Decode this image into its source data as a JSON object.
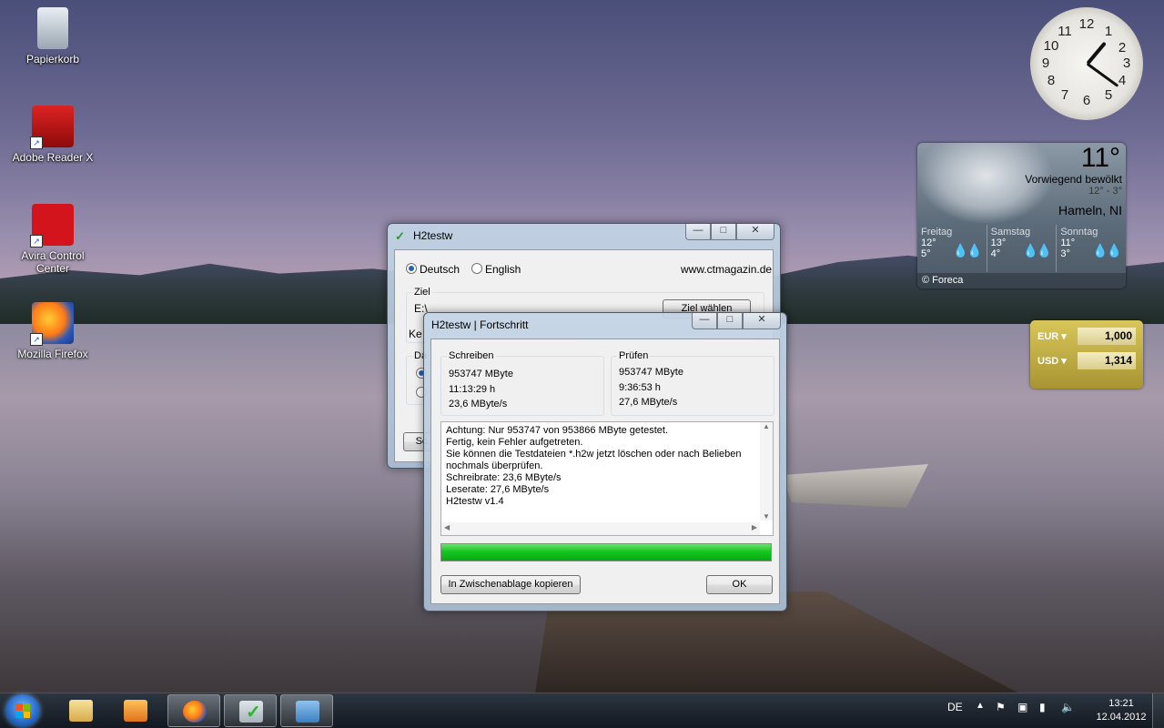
{
  "desktop": {
    "icons": [
      {
        "label": "Papierkorb"
      },
      {
        "label": "Adobe Reader X"
      },
      {
        "label": "Avira Control Center"
      },
      {
        "label": "Mozilla Firefox"
      }
    ]
  },
  "weather": {
    "temp": "11°",
    "condition": "Vorwiegend bewölkt",
    "range": "12°  -  3°",
    "city": "Hameln, NI",
    "days": [
      {
        "name": "Freitag",
        "hi": "12°",
        "lo": "5°"
      },
      {
        "name": "Samstag",
        "hi": "13°",
        "lo": "4°"
      },
      {
        "name": "Sonntag",
        "hi": "11°",
        "lo": "3°"
      }
    ],
    "source": "© Foreca"
  },
  "currency": {
    "rows": [
      {
        "code": "EUR",
        "value": "1,000"
      },
      {
        "code": "USD",
        "value": "1,314"
      }
    ]
  },
  "main_window": {
    "title": "H2testw",
    "lang_de": "Deutsch",
    "lang_en": "English",
    "url": "www.ctmagazin.de",
    "target_group": "Ziel",
    "target_value": "E:\\",
    "choose_target": "Ziel wählen",
    "partial_ke": "Ke",
    "partial_da": "Da",
    "partial_sc": "Sc"
  },
  "progress_window": {
    "title": "H2testw | Fortschritt",
    "write": {
      "label": "Schreiben",
      "amount": "953747 MByte",
      "time": "11:13:29 h",
      "rate": "23,6 MByte/s"
    },
    "verify": {
      "label": "Prüfen",
      "amount": "953747 MByte",
      "time": "9:36:53 h",
      "rate": "27,6 MByte/s"
    },
    "log": [
      "Achtung: Nur 953747 von 953866 MByte getestet.",
      "Fertig, kein Fehler aufgetreten.",
      "Sie können die Testdateien *.h2w jetzt löschen oder nach Belieben",
      "nochmals überprüfen.",
      "Schreibrate: 23,6 MByte/s",
      "Leserate: 27,6 MByte/s",
      "H2testw v1.4"
    ],
    "progress": 1.0,
    "copy_button": "In Zwischenablage kopieren",
    "ok_button": "OK"
  },
  "taskbar": {
    "language": "DE",
    "time": "13:21",
    "date": "12.04.2012"
  },
  "colors": {
    "progress_fill": "#14c71f",
    "window_frame": "#b8c9dc",
    "taskbar": "#1a2530"
  }
}
